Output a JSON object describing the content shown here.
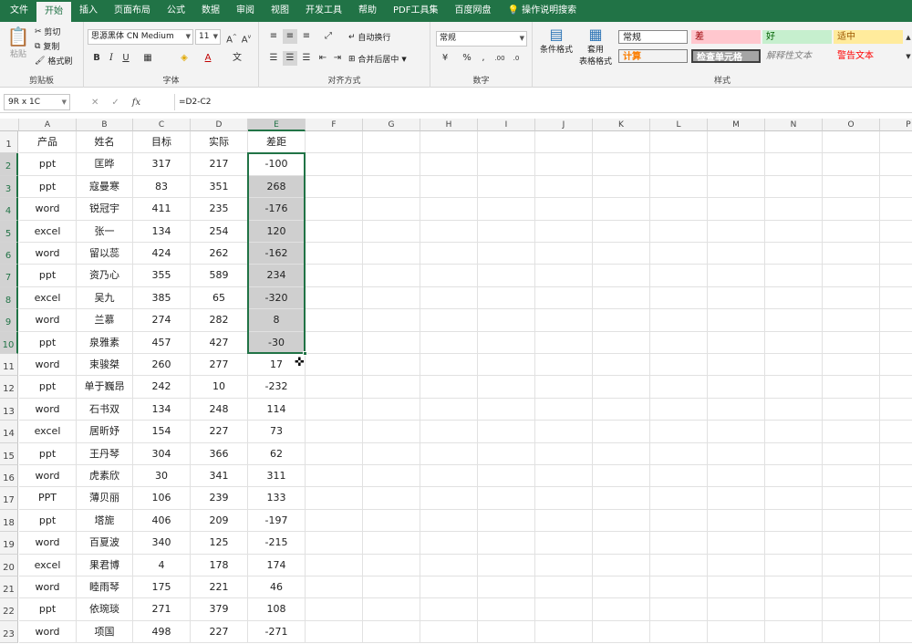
{
  "tabs": [
    "文件",
    "开始",
    "插入",
    "页面布局",
    "公式",
    "数据",
    "审阅",
    "视图",
    "开发工具",
    "帮助",
    "PDF工具集",
    "百度网盘",
    "操作说明搜索"
  ],
  "active_tab": "开始",
  "ribbon": {
    "clipboard": {
      "cut": "剪切",
      "copy": "复制",
      "format_painter": "格式刷",
      "paste": "粘贴",
      "group": "剪贴板"
    },
    "font": {
      "name": "思源黑体 CN Medium",
      "size": "11",
      "group": "字体"
    },
    "alignment": {
      "wrap": "自动换行",
      "merge": "合并后居中",
      "group": "对齐方式"
    },
    "number": {
      "format": "常规",
      "group": "数字"
    },
    "styles": {
      "conditional": "条件格式",
      "table_fmt_1": "套用",
      "table_fmt_2": "表格格式",
      "group": "样式",
      "normal": "常规",
      "bad": "差",
      "good": "好",
      "neutral": "适中",
      "calculation": "计算",
      "check_cell": "检查单元格",
      "explanatory": "解释性文本",
      "warning": "警告文本"
    }
  },
  "name_box": "9R x 1C",
  "formula": "=D2-C2",
  "columns": [
    "A",
    "B",
    "C",
    "D",
    "E",
    "F",
    "G",
    "H",
    "I",
    "J",
    "K",
    "L",
    "M",
    "N",
    "O",
    "P"
  ],
  "headers": [
    "产品",
    "姓名",
    "目标",
    "实际",
    "差距"
  ],
  "rows": [
    [
      "ppt",
      "匡晔",
      "317",
      "217",
      "-100"
    ],
    [
      "ppt",
      "寇曼寒",
      "83",
      "351",
      "268"
    ],
    [
      "word",
      "锐冠宇",
      "411",
      "235",
      "-176"
    ],
    [
      "excel",
      "张一",
      "134",
      "254",
      "120"
    ],
    [
      "word",
      "留以蕊",
      "424",
      "262",
      "-162"
    ],
    [
      "ppt",
      "资乃心",
      "355",
      "589",
      "234"
    ],
    [
      "excel",
      "吴九",
      "385",
      "65",
      "-320"
    ],
    [
      "word",
      "兰慕",
      "274",
      "282",
      "8"
    ],
    [
      "ppt",
      "泉雅素",
      "457",
      "427",
      "-30"
    ],
    [
      "word",
      "束骏桀",
      "260",
      "277",
      "17"
    ],
    [
      "ppt",
      "单于巍昂",
      "242",
      "10",
      "-232"
    ],
    [
      "word",
      "石书双",
      "134",
      "248",
      "114"
    ],
    [
      "excel",
      "居昕妤",
      "154",
      "227",
      "73"
    ],
    [
      "ppt",
      "王丹琴",
      "304",
      "366",
      "62"
    ],
    [
      "word",
      "虎素欣",
      "30",
      "341",
      "311"
    ],
    [
      "PPT",
      "薄贝丽",
      "106",
      "239",
      "133"
    ],
    [
      "ppt",
      "塔旎",
      "406",
      "209",
      "-197"
    ],
    [
      "word",
      "百夏波",
      "340",
      "125",
      "-215"
    ],
    [
      "excel",
      "果君博",
      "4",
      "178",
      "174"
    ],
    [
      "word",
      "睦雨琴",
      "175",
      "221",
      "46"
    ],
    [
      "ppt",
      "依琬琰",
      "271",
      "379",
      "108"
    ],
    [
      "word",
      "项国",
      "498",
      "227",
      "-271"
    ]
  ],
  "colors": {
    "excel_green": "#217346",
    "selection_fill": "#cfcfcf"
  }
}
